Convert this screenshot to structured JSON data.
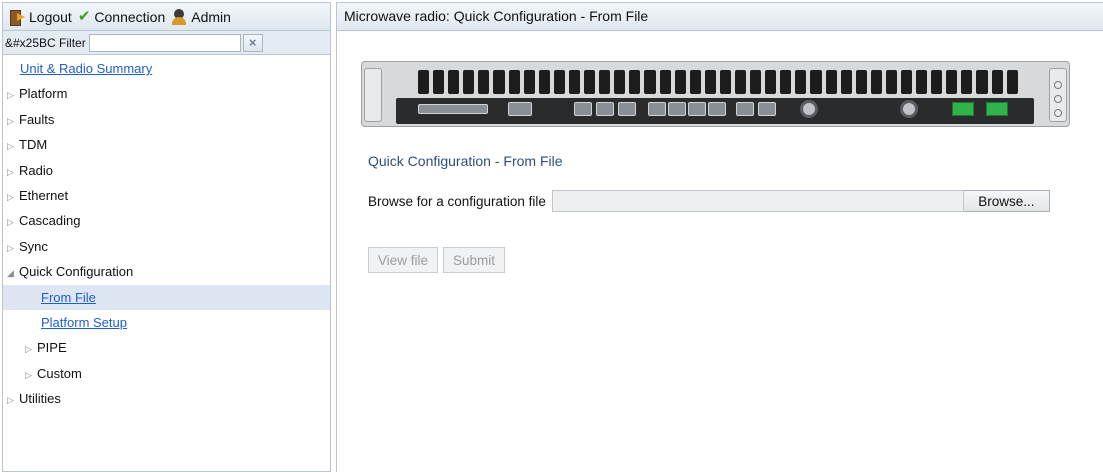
{
  "toolbar": {
    "logout_label": "Logout",
    "connection_label": "Connection",
    "admin_label": "Admin"
  },
  "filter": {
    "prefix": "&#x25BC Filter",
    "value": "",
    "clear_glyph": "×"
  },
  "tree": {
    "unit_summary": "Unit & Radio Summary",
    "platform": "Platform",
    "faults": "Faults",
    "tdm": "TDM",
    "radio": "Radio",
    "ethernet": "Ethernet",
    "cascading": "Cascading",
    "sync": "Sync",
    "quick_config": "Quick Configuration",
    "from_file": "From File",
    "platform_setup": "Platform Setup",
    "pipe": "PIPE",
    "custom": "Custom",
    "utilities": "Utilities"
  },
  "glyphs": {
    "collapsed": "▷",
    "expanded": "◢"
  },
  "main": {
    "header_title": "Microwave radio: Quick Configuration - From File",
    "section_title": "Quick Configuration - From File",
    "browse_label": "Browse for a configuration file",
    "browse_button": "Browse...",
    "view_file_button": "View file",
    "submit_button": "Submit"
  },
  "colors": {
    "link": "#1f5fcc",
    "section_title": "#2d4f77",
    "selected_row": "#dfe6f3"
  }
}
